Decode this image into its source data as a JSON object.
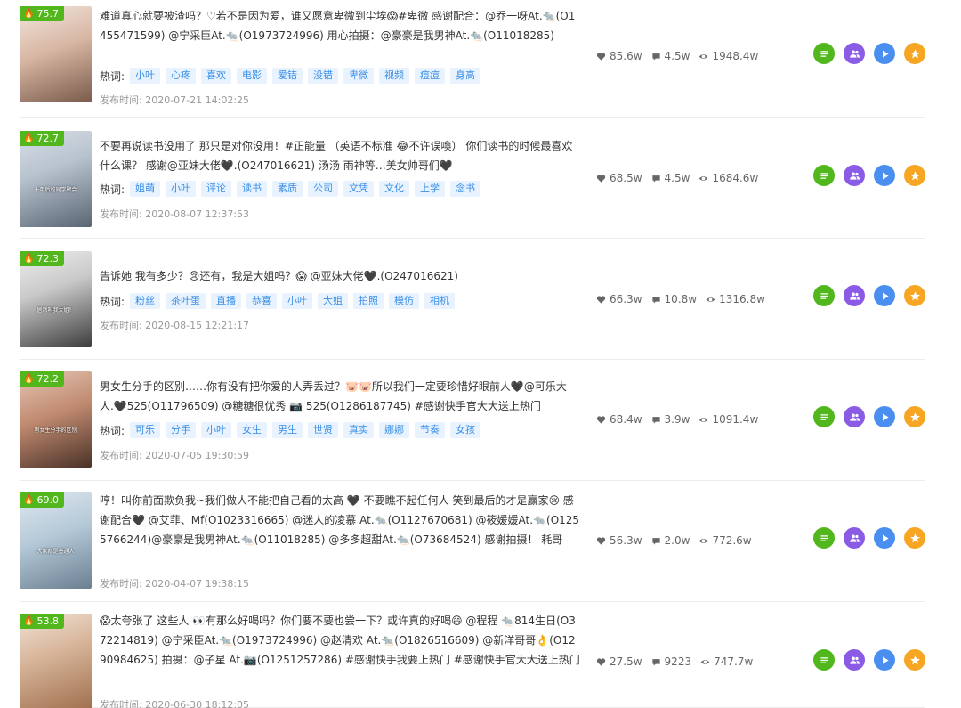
{
  "labels": {
    "tags_prefix": "热词:",
    "time_prefix": "发布时间:"
  },
  "colors": {
    "heat": "#52b61d",
    "tag_text": "#3a8ee6",
    "tag_bg": "#e8f3ff"
  },
  "items": [
    {
      "heat": "75.7",
      "thumb_caption": "",
      "description": "难道真心就要被渣吗？♡若不是因为爱，谁又愿意卑微到尘埃😱#卑微 感谢配合：@乔一呀At.🐀(O1455471599) @宁采臣At.🐀(O1973724996) 用心拍摄：@豪豪是我男神At.🐀(O11018285)",
      "tags": [
        "小叶",
        "心疼",
        "喜欢",
        "电影",
        "爱错",
        "没错",
        "卑微",
        "视频",
        "痘痘",
        "身高"
      ],
      "time": "2020-07-21 14:02:25",
      "likes": "85.6w",
      "comments": "4.5w",
      "views": "1948.4w"
    },
    {
      "heat": "72.7",
      "thumb_caption": "十年后的同学聚会",
      "description": "不要再说读书没用了 那只是对你没用！#正能量 （英语不标准 😂不许误喚） 你们读书的时候最喜欢什么课？ 感谢@亚妹大佬🖤.(O247016621) 汤汤 雨神等…美女帅哥们🖤",
      "tags": [
        "姐萌",
        "小叶",
        "评论",
        "读书",
        "素质",
        "公司",
        "文凭",
        "文化",
        "上学",
        "念书"
      ],
      "time": "2020-08-07 12:37:53",
      "likes": "68.5w",
      "comments": "4.5w",
      "views": "1684.6w"
    },
    {
      "heat": "72.3",
      "thumb_caption": "居然叫我大姐！",
      "description": "告诉她 我有多少？😢还有，我是大姐吗？😱 @亚妹大佬🖤.(O247016621)",
      "tags": [
        "粉丝",
        "茶叶蛋",
        "直播",
        "恭喜",
        "小叶",
        "大姐",
        "拍照",
        "模仿",
        "相机"
      ],
      "time": "2020-08-15 12:21:17",
      "likes": "66.3w",
      "comments": "10.8w",
      "views": "1316.8w"
    },
    {
      "heat": "72.2",
      "thumb_caption": "男女生分手的区别",
      "description": "男女生分手的区别……你有没有把你爱的人弄丢过？🐷🐷所以我们一定要珍惜好眼前人🖤@可乐大人.🖤525(O11796509) @糖糖很优秀 📷 525(O1286187745) #感谢快手官大大送上热门",
      "tags": [
        "可乐",
        "分手",
        "小叶",
        "女生",
        "男生",
        "世贤",
        "真实",
        "娜娜",
        "节奏",
        "女孩"
      ],
      "time": "2020-07-05 19:30:59",
      "likes": "68.4w",
      "comments": "3.9w",
      "views": "1091.4w"
    },
    {
      "heat": "69.0",
      "thumb_caption": "大家都是普通人",
      "description": "哼！叫你前面欺负我~我们做人不能把自己看的太高 🖤 不要瞧不起任何人 笑到最后的才是赢家😢 感谢配合🖤 @艾菲、Mf(O1023316665) @迷人的凌慕 At.🐀(O1127670681) @筱媛媛At.🐀(O1255766244)@豪豪是我男神At.🐀(O11018285) @多多超甜At.🐀(O73684524) 感谢拍摄！ 耗哥",
      "tags": [],
      "time": "2020-04-07 19:38:15",
      "likes": "56.3w",
      "comments": "2.0w",
      "views": "772.6w"
    },
    {
      "heat": "53.8",
      "thumb_caption": "",
      "description": "😱太夸张了 这些人 👀有那么好喝吗？你们要不要也尝一下？或许真的好喝😄 @程程 🐀814生日(O372214819) @宁采臣At.🐀(O1973724996) @赵清欢 At.🐀(O1826516609) @新洋哥哥👌(O1290984625) 拍摄：@子星 At.📷(O1251257286) #感谢快手我要上热门 #感谢快手官大大送上热门 #支持快手传播正能量 #搞笑",
      "tags": [],
      "time": "2020-06-30 18:12:05",
      "likes": "27.5w",
      "comments": "9223",
      "views": "747.7w"
    }
  ]
}
